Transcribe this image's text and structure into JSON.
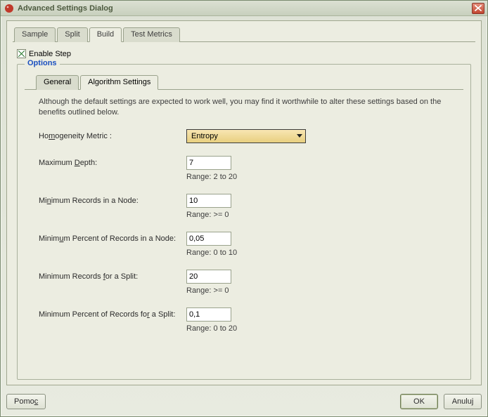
{
  "window": {
    "title": "Advanced Settings Dialog",
    "icon": "app-icon",
    "close_label": "Close"
  },
  "tabs": {
    "sample": "Sample",
    "split": "Split",
    "build": "Build",
    "test_metrics": "Test Metrics",
    "active": "build"
  },
  "enable": {
    "label": "Enable Step",
    "underline_char": "E",
    "checked": true
  },
  "options": {
    "legend": "Options",
    "tabs": {
      "general": "General",
      "algorithm": "Algorithm Settings",
      "active": "algorithm"
    },
    "description": "Although the default settings are expected to work well, you may find it worthwhile to alter these settings based on the benefits outlined below.",
    "fields": {
      "homogeneity": {
        "label_pre": "Ho",
        "label_u": "m",
        "label_post": "ogeneity Metric :",
        "value": "Entropy"
      },
      "max_depth": {
        "label_pre": "Maximum ",
        "label_u": "D",
        "label_post": "epth:",
        "value": "7",
        "range": "Range: 2 to 20"
      },
      "min_records_node": {
        "label_pre": "Mi",
        "label_u": "n",
        "label_post": "imum Records in a Node:",
        "value": "10",
        "range": "Range: >= 0"
      },
      "min_percent_node": {
        "label_pre": "Minim",
        "label_u": "u",
        "label_post": "m Percent of Records in a Node:",
        "value": "0,05",
        "range": "Range: 0 to 10"
      },
      "min_records_split": {
        "label_pre": "Minimum Records ",
        "label_u": "f",
        "label_post": "or a Split:",
        "value": "20",
        "range": "Range: >= 0"
      },
      "min_percent_split": {
        "label_pre": "Minimum Percent of Records fo",
        "label_u": "r",
        "label_post": " a Split:",
        "value": "0,1",
        "range": "Range: 0 to 20"
      }
    }
  },
  "footer": {
    "help_pre": "Pomo",
    "help_u": "c",
    "ok": "OK",
    "cancel": "Anuluj"
  }
}
